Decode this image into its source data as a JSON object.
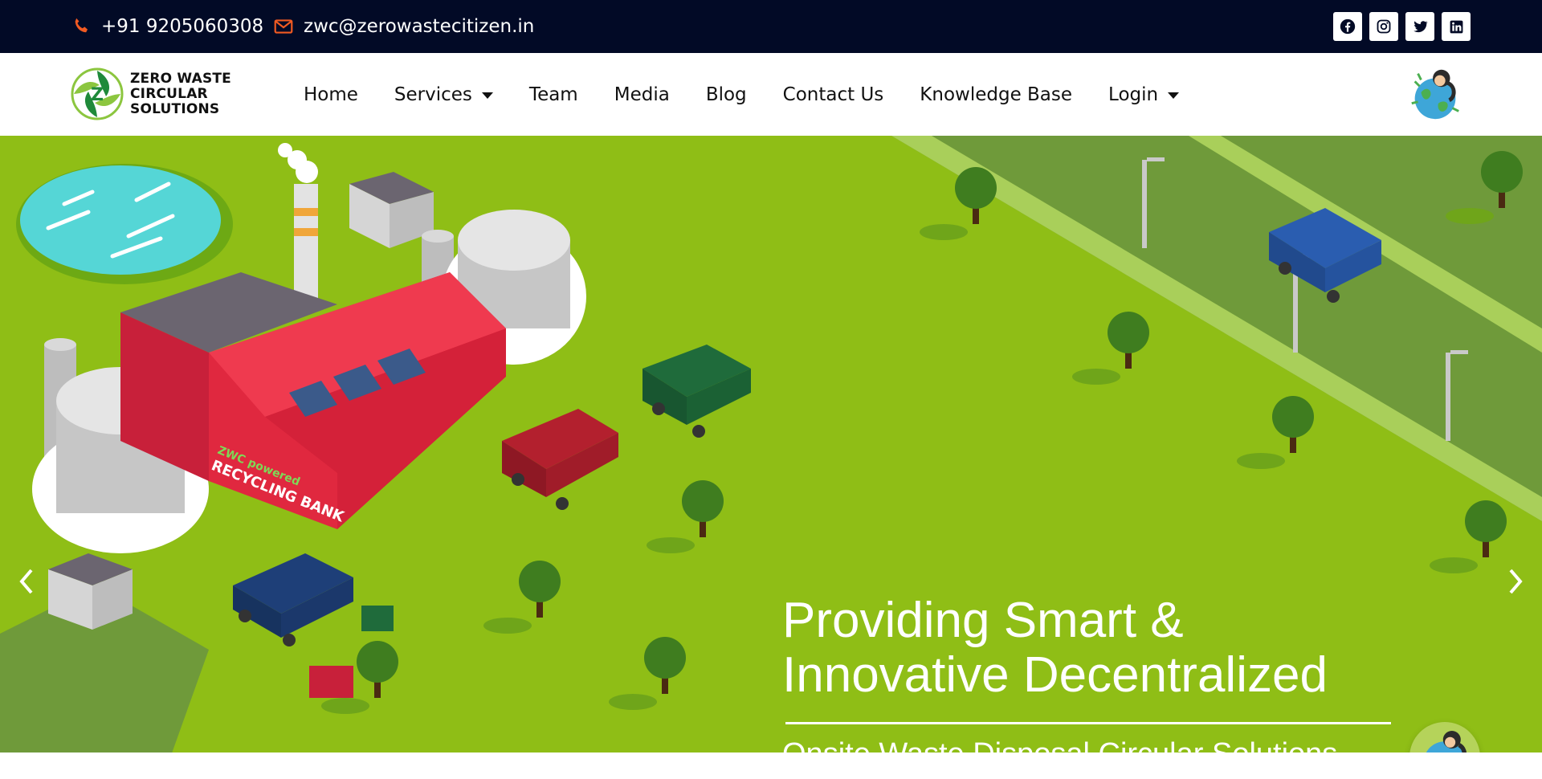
{
  "topbar": {
    "phone": "+91 9205060308",
    "email": "zwc@zerowastecitizen.in",
    "phone_icon": "phone-icon",
    "email_icon": "envelope-icon",
    "socials": [
      "facebook-icon",
      "instagram-icon",
      "twitter-icon",
      "linkedin-icon"
    ],
    "background": "#020a26",
    "icon_color": "#f15a22"
  },
  "brand": {
    "line1": "ZERO WASTE",
    "line2": "CIRCULAR",
    "line3": "SOLUTIONS",
    "logo_colors": [
      "#1f8a3a",
      "#8cc63f"
    ]
  },
  "nav": {
    "items": [
      {
        "label": "Home",
        "dropdown": false
      },
      {
        "label": "Services",
        "dropdown": true
      },
      {
        "label": "Team",
        "dropdown": false
      },
      {
        "label": "Media",
        "dropdown": false
      },
      {
        "label": "Blog",
        "dropdown": false
      },
      {
        "label": "Contact Us",
        "dropdown": false
      },
      {
        "label": "Knowledge Base",
        "dropdown": false
      },
      {
        "label": "Login",
        "dropdown": true
      }
    ]
  },
  "hero": {
    "headline_line1": "Providing Smart &",
    "headline_line2": "Innovative Decentralized",
    "subheadline": "Onsite Waste Disposal Circular Solutions",
    "factory_sign_line1": "ZWC powered",
    "factory_sign_line2": "RECYCLING BANK",
    "prev_icon": "chevron-left-icon",
    "next_icon": "chevron-right-icon",
    "grass_color": "#8fbe16",
    "road_color": "#6f9a3a",
    "factory_color": "#e0283f"
  }
}
